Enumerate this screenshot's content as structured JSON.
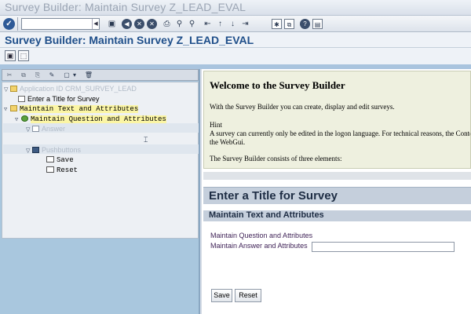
{
  "window": {
    "title": "Survey Builder: Maintain Survey Z_LEAD_EVAL"
  },
  "toolbar": {
    "command_field_value": "",
    "icons": [
      "enter-icon",
      "save-icon",
      "back-icon",
      "exit-icon",
      "cancel-icon",
      "print-icon",
      "find-icon",
      "find-next-icon",
      "first-page-icon",
      "previous-page-icon",
      "next-page-icon",
      "last-page-icon",
      "new-session-icon",
      "shortcut-icon",
      "help-icon",
      "customize-layout-icon"
    ]
  },
  "screen": {
    "title": "Survey Builder: Maintain Survey Z_LEAD_EVAL"
  },
  "tree": {
    "nodes": [
      {
        "label": "Application ID CRM_SURVEY_LEAD",
        "level": 0,
        "expanded": true,
        "icon": "folder-icon",
        "style": "greyed"
      },
      {
        "label": "Enter a Title for Survey",
        "level": 1,
        "icon": "document-icon",
        "style": "normal"
      },
      {
        "label": "Maintain Text and Attributes",
        "level": 0,
        "expanded": true,
        "icon": "folder-icon",
        "style": "highlight"
      },
      {
        "label": "Maintain Question and Attributes",
        "level": 1,
        "expanded": true,
        "icon": "question-icon",
        "style": "highlight"
      },
      {
        "label": "Answer",
        "level": 2,
        "expanded": true,
        "icon": "answer-icon",
        "style": "greyed"
      },
      {
        "label": "Pushbuttons",
        "level": 1,
        "expanded": true,
        "icon": "pushbuttons-icon",
        "style": "greyed"
      },
      {
        "label": "Save",
        "level": 2,
        "icon": "button-icon",
        "style": "normal"
      },
      {
        "label": "Reset",
        "level": 2,
        "icon": "button-icon",
        "style": "normal"
      }
    ]
  },
  "welcome": {
    "heading": "Welcome to the Survey Builder",
    "intro": "With the Survey Builder you can create, display and edit surveys.",
    "hint_label": "Hint",
    "hint_line1": "A survey can currently only be edited in the logon language. For technical reasons, the Conte",
    "hint_line2": "the WebGui.",
    "elements_text": "The Survey Builder consists of three elements:"
  },
  "preview": {
    "title": "Enter a Title for Survey",
    "section": "Maintain Text and Attributes",
    "question_label": "Maintain Question and Attributes",
    "answer_label": "Maintain Answer and Attributes",
    "answer_value": "",
    "save_button": "Save",
    "reset_button": "Reset"
  }
}
